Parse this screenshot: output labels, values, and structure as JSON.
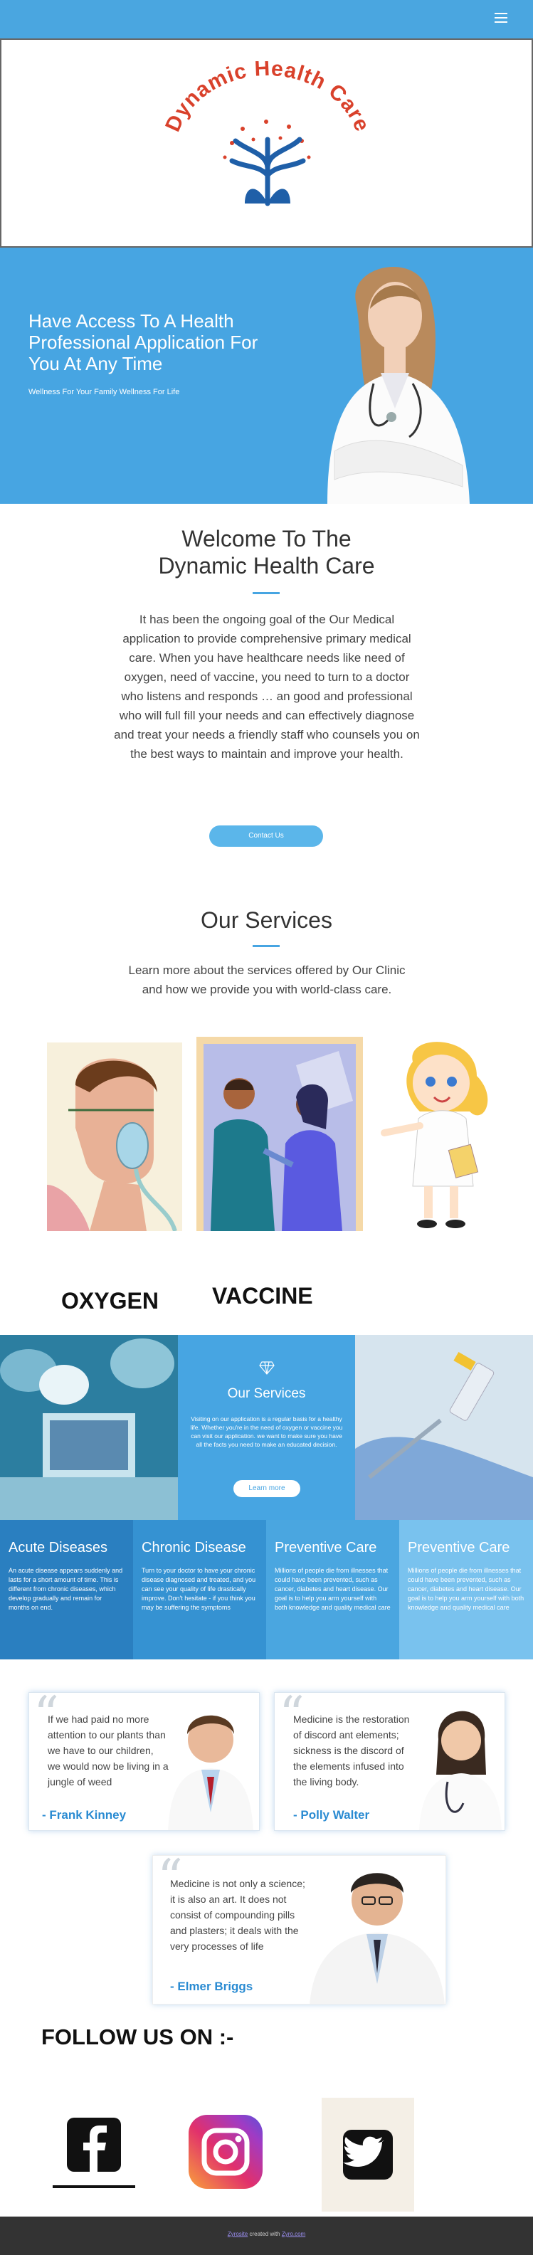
{
  "brand": {
    "name": "Dynamic Health Care"
  },
  "hero": {
    "title": "Have Access To A Health Professional Application For You At Any Time",
    "subtitle": "Wellness For Your Family Wellness For Life"
  },
  "welcome": {
    "title_line1": "Welcome To The",
    "title_line2": "Dynamic Health Care",
    "body": "It has been the ongoing goal of the Our Medical application to provide comprehensive primary medical care. When you have healthcare needs like need of oxygen, need of vaccine, you need to turn to a doctor who listens and responds … an good and  professional who will full fill your needs  and can effectively diagnose and treat your needs a friendly staff who counsels you on the best ways to maintain and improve your health.",
    "button": "Contact Us"
  },
  "services": {
    "title": "Our Services",
    "body": "Learn more about the services offered by Our Clinic and how we provide you with world-class care.",
    "items": [
      {
        "label": "OXYGEN"
      },
      {
        "label": "VACCINE"
      }
    ]
  },
  "band": {
    "title": "Our Services",
    "body": "Visiting on our application is a  regular basis  for a healthy life. Whether you're in the need of oxygen or vaccine you can visit our application. we want to make sure you have all the facts you need to make an educated decision.",
    "button": "Learn more"
  },
  "features": [
    {
      "title": "Acute Diseases",
      "body": "An acute disease appears suddenly and lasts for a short amount of time. This is different from chronic diseases, which develop gradually and remain for months on end.",
      "color": "#2a7fc0"
    },
    {
      "title": "Chronic Disease",
      "body": "Turn to your doctor to have your chronic disease diagnosed and treated, and you can see your quality of life drastically improve. Don't hesitate - if you think you may be suffering the symptoms",
      "color": "#3592d2"
    },
    {
      "title": "Preventive Care",
      "body": "Millions of people die from illnesses that could have been prevented, such as cancer, diabetes and heart disease. Our goal is to help you arm yourself with both knowledge and quality medical care",
      "color": "#4aa6e0"
    },
    {
      "title": "Preventive Care",
      "body": "Millions of people die from illnesses that could have been prevented, such as cancer, diabetes and heart disease. Our goal is to help you arm yourself with both knowledge and quality medical care",
      "color": "#79c2ee"
    }
  ],
  "testimonials": [
    {
      "quote": "If we had paid no more attention to our plants than we have to our children, we would now be living in a jungle of weed",
      "author": "- Frank Kinney"
    },
    {
      "quote": "Medicine is the restoration of discord ant elements; sickness is the discord of the elements infused into the living body.",
      "author": "- Polly Walter"
    },
    {
      "quote": "Medicine is not only a science; it is also an art. It does not consist of compounding pills and plasters; it deals with the very processes of life",
      "author": "- Elmer Briggs"
    }
  ],
  "follow": {
    "title": "FOLLOW US ON  :-"
  },
  "social": [
    {
      "icon": "facebook-icon"
    },
    {
      "icon": "instagram-icon"
    },
    {
      "icon": "twitter-icon"
    }
  ],
  "footer": {
    "text": "created with",
    "brand_left": "Zyrosite",
    "brand_right": "Zyro.com"
  },
  "colors": {
    "primary": "#47a5e2",
    "dark_footer": "#333333",
    "accent_text": "#2a8bd2",
    "logo_red": "#d9412b",
    "logo_blue": "#1f5fa8"
  }
}
